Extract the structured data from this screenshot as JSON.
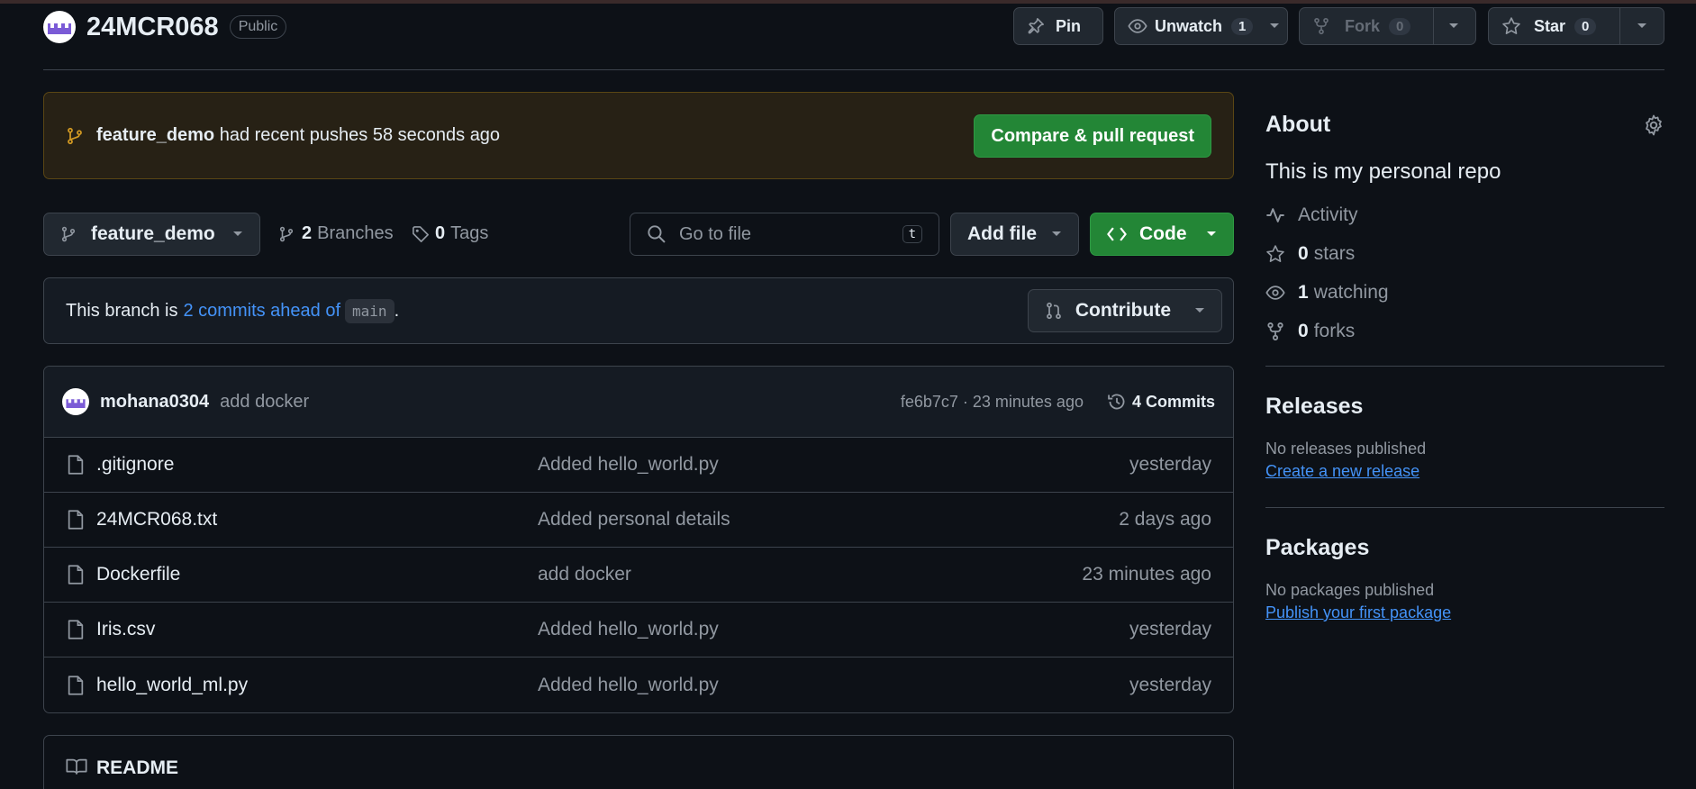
{
  "repo": {
    "name": "24MCR068",
    "visibility": "Public"
  },
  "header_actions": {
    "pin_label": "Pin",
    "unwatch_label": "Unwatch",
    "unwatch_count": "1",
    "fork_label": "Fork",
    "fork_count": "0",
    "star_label": "Star",
    "star_count": "0"
  },
  "banner": {
    "branch": "feature_demo",
    "text": "had recent pushes 58 seconds ago",
    "button": "Compare & pull request"
  },
  "toolbar": {
    "branch": "feature_demo",
    "branches_count": "2",
    "branches_label": "Branches",
    "tags_count": "0",
    "tags_label": "Tags",
    "search_placeholder": "Go to file",
    "search_shortcut": "t",
    "add_file": "Add file",
    "code": "Code"
  },
  "ahead": {
    "prefix": "This branch is",
    "link": "2 commits ahead of",
    "base": "main",
    "suffix": ".",
    "contribute": "Contribute"
  },
  "latest_commit": {
    "author": "mohana0304",
    "message": "add docker",
    "hash_time": "fe6b7c7 · 23 minutes ago",
    "commits_label": "4 Commits"
  },
  "files": [
    {
      "name": ".gitignore",
      "message": "Added hello_world.py",
      "date": "yesterday"
    },
    {
      "name": "24MCR068.txt",
      "message": "Added personal details",
      "date": "2 days ago"
    },
    {
      "name": "Dockerfile",
      "message": "add docker",
      "date": "23 minutes ago"
    },
    {
      "name": "Iris.csv",
      "message": "Added hello_world.py",
      "date": "yesterday"
    },
    {
      "name": "hello_world_ml.py",
      "message": "Added hello_world.py",
      "date": "yesterday"
    }
  ],
  "readme_label": "README",
  "about": {
    "title": "About",
    "description": "This is my personal repo",
    "activity": "Activity",
    "stars_count": "0",
    "stars_label": "stars",
    "watching_count": "1",
    "watching_label": "watching",
    "forks_count": "0",
    "forks_label": "forks"
  },
  "releases": {
    "title": "Releases",
    "empty": "No releases published",
    "link": "Create a new release"
  },
  "packages": {
    "title": "Packages",
    "empty": "No packages published",
    "link": "Publish your first package"
  },
  "colors": {
    "accent_green": "#238636",
    "link_blue": "#4493f8",
    "bg": "#0d1117"
  }
}
